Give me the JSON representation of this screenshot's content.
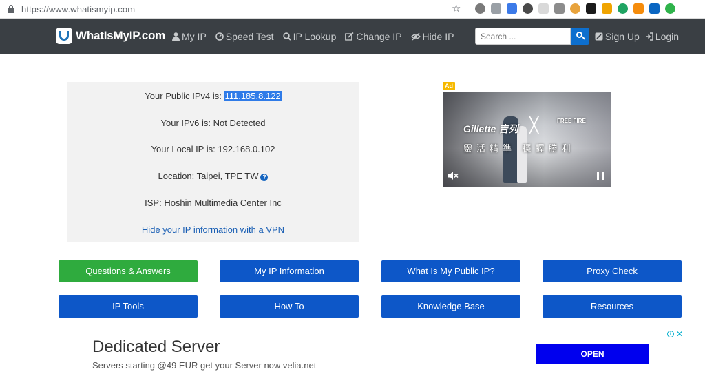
{
  "browser": {
    "url": "https://www.whatismyip.com",
    "extension_colors": [
      "#7a7a7a",
      "#9aa0a6",
      "#3c7ae8",
      "#4a4a4a",
      "#d9d9d9",
      "#8c8c8c",
      "#e8a33c",
      "#1a1a1a",
      "#f0a400",
      "#1fa463",
      "#f58c0c",
      "#0a66c2",
      "#2fb34b"
    ]
  },
  "nav": {
    "brand": "WhatIsMyIP.com",
    "links": [
      {
        "icon": "user-icon",
        "label": "My IP"
      },
      {
        "icon": "speedometer-icon",
        "label": "Speed Test"
      },
      {
        "icon": "search-icon",
        "label": "IP Lookup"
      },
      {
        "icon": "edit-icon",
        "label": "Change IP"
      },
      {
        "icon": "eye-slash-icon",
        "label": "Hide IP"
      }
    ],
    "search_placeholder": "Search ...",
    "signup": "Sign Up",
    "login": "Login"
  },
  "ip_info": {
    "ipv4_label": "Your Public IPv4 is: ",
    "ipv4_value": "111.185.8.122",
    "ipv6": "Your IPv6 is: Not Detected",
    "local_ip": "Your Local IP is: 192.168.0.102",
    "location": "Location: Taipei, TPE TW",
    "isp": "ISP: Hoshin Multimedia Center Inc",
    "vpn_link": "Hide your IP information with a VPN"
  },
  "ad": {
    "label": "Ad",
    "brand": "Gillette 吉列",
    "game": "FREE FIRE",
    "slogan": "靈活精準 穩握勝利"
  },
  "buttons": [
    "Questions & Answers",
    "My IP Information",
    "What Is My Public IP?",
    "Proxy Check",
    "IP Tools",
    "How To",
    "Knowledge Base",
    "Resources"
  ],
  "bottom_ad": {
    "title": "Dedicated Server",
    "subtitle": "Servers starting @49 EUR get your Server now velia.net",
    "cta": "OPEN"
  },
  "colors": {
    "nav_bg": "#3a3f44",
    "button_blue": "#0d57c8",
    "button_green": "#2fab3e",
    "highlight": "#2f7be8"
  }
}
